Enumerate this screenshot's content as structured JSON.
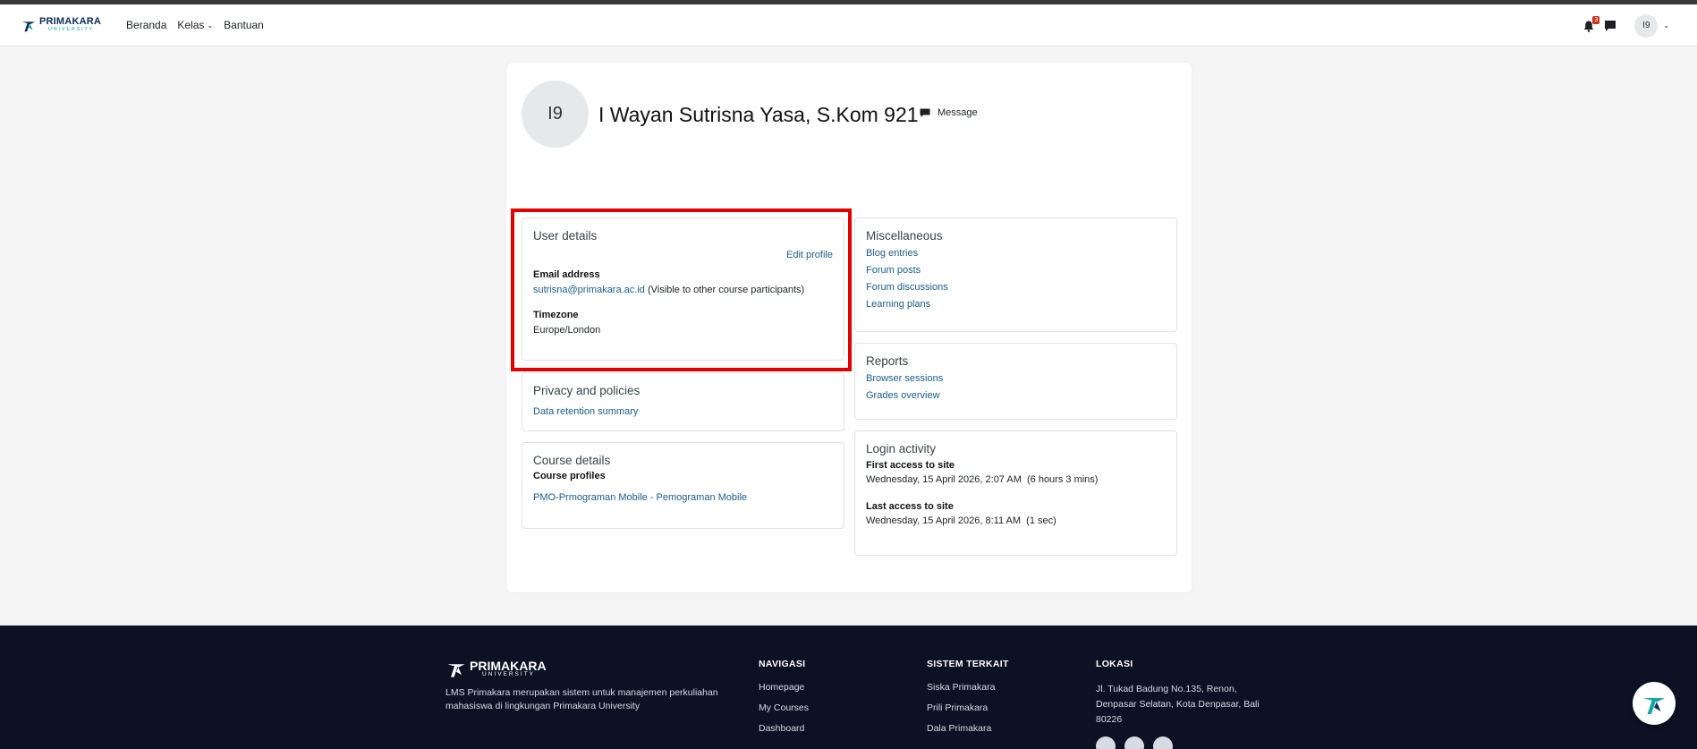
{
  "header": {
    "logo_main": "PRIMAKARA",
    "logo_sub": "UNIVERSITY",
    "nav": [
      "Beranda",
      "Kelas",
      "Bantuan"
    ],
    "notification_count": "3",
    "user_initials": "I9"
  },
  "profile": {
    "initials": "I9",
    "name": "I Wayan Sutrisna Yasa, S.Kom 921",
    "message_label": "Message"
  },
  "user_details": {
    "title": "User details",
    "edit_label": "Edit profile",
    "email_label": "Email address",
    "email": "sutrisna@primakara.ac.id",
    "email_note": "(Visible to other course participants)",
    "timezone_label": "Timezone",
    "timezone": "Europe/London"
  },
  "privacy": {
    "title": "Privacy and policies",
    "link": "Data retention summary"
  },
  "course_details": {
    "title": "Course details",
    "subtitle": "Course profiles",
    "course": "PMO-Prmograman Mobile - Pemograman Mobile"
  },
  "misc": {
    "title": "Miscellaneous",
    "links": [
      "Blog entries",
      "Forum posts",
      "Forum discussions",
      "Learning plans"
    ]
  },
  "reports": {
    "title": "Reports",
    "links": [
      "Browser sessions",
      "Grades overview"
    ]
  },
  "login": {
    "title": "Login activity",
    "first_label": "First access to site",
    "first_value": "Wednesday, 15 April 2026, 2:07 AM  (6 hours 3 mins)",
    "last_label": "Last access to site",
    "last_value": "Wednesday, 15 April 2026, 8:11 AM  (1 sec)"
  },
  "footer": {
    "logo_main": "PRIMAKARA",
    "logo_sub": "UNIVERSITY",
    "description": "LMS Primakara merupakan sistem untuk manajemen perkuliahan mahasiswa di lingkungan Primakara University",
    "nav_title": "NAVIGASI",
    "nav_items": [
      "Homepage",
      "My Courses",
      "Dashboard"
    ],
    "sys_title": "SISTEM TERKAIT",
    "sys_items": [
      "Siska Primakara",
      "Prili Primakara",
      "Dala Primakara"
    ],
    "loc_title": "LOKASI",
    "address": "Jl. Tukad Badung No.135, Renon, Denpasar Selatan, Kota Denpasar, Bali 80226"
  },
  "colors": {
    "brand_dark": "#0b2a5a",
    "brand_teal": "#1aa3a3",
    "link": "#1a5c8a",
    "highlight": "#e00000",
    "footer_bg": "#0c1124"
  },
  "icons": [
    "bell-icon",
    "chat-icon",
    "chevron-down-icon",
    "message-icon",
    "primakara-logo-icon",
    "instagram-icon",
    "tiktok-icon",
    "facebook-icon"
  ]
}
